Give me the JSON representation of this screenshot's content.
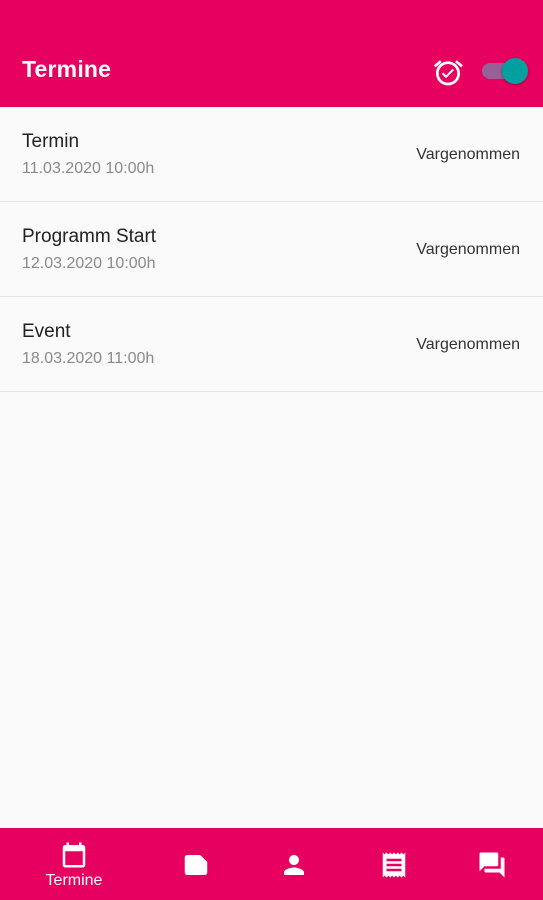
{
  "colors": {
    "primary": "#e6005f",
    "toggle_thumb": "#00a0a0",
    "toggle_track": "#8e6b9e"
  },
  "appbar": {
    "title": "Termine",
    "alarm_icon": "alarm-check-icon",
    "toggle_state": "on"
  },
  "appointments": [
    {
      "title": "Termin",
      "date": "11.03.2020 10:00h",
      "status": "Vargenommen"
    },
    {
      "title": "Programm Start",
      "date": "12.03.2020 10:00h",
      "status": "Vargenommen"
    },
    {
      "title": "Event",
      "date": "18.03.2020 11:00h",
      "status": "Vargenommen"
    }
  ],
  "bottom_nav": {
    "items": [
      {
        "icon": "calendar-icon",
        "label": "Termine",
        "active": true
      },
      {
        "icon": "label-icon",
        "label": "",
        "active": false
      },
      {
        "icon": "person-icon",
        "label": "",
        "active": false
      },
      {
        "icon": "receipt-icon",
        "label": "",
        "active": false
      },
      {
        "icon": "forum-icon",
        "label": "",
        "active": false
      }
    ]
  }
}
